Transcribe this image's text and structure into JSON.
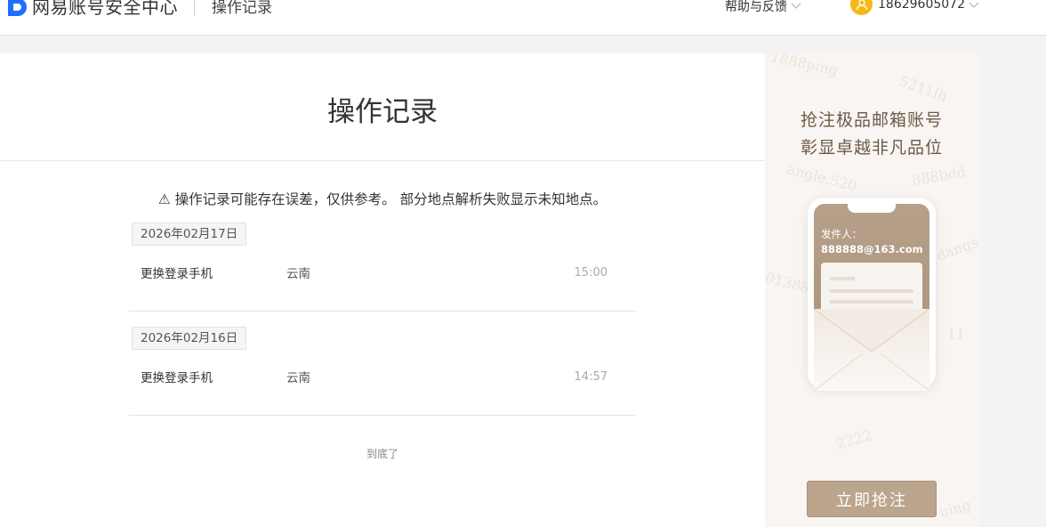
{
  "header": {
    "brand": "网易账号安全中心",
    "page_name": "操作记录",
    "help_label": "帮助与反馈",
    "user_phone": "18629605072"
  },
  "main": {
    "title": "操作记录",
    "notice": "⚠ 操作记录可能存在误差，仅供参考。 部分地点解析失败显示未知地点。",
    "records": [
      {
        "date": "2026年02月17日",
        "action": "更换登录手机",
        "location": "云南",
        "time": "15:00"
      },
      {
        "date": "2026年02月16日",
        "action": "更换登录手机",
        "location": "云南",
        "time": "14:57"
      }
    ],
    "end_text": "到底了"
  },
  "ad": {
    "line1": "抢注极品邮箱账号",
    "line2": "彰显卓越非凡品位",
    "sender_label": "发件人：",
    "sender_email": "888888@163.com",
    "button_label": "立即抢注",
    "watermarks": [
      "1888ping",
      "5211lh",
      "angle.520",
      "888bdd",
      "dangs",
      "01388",
      "2222",
      "11",
      "uing"
    ]
  },
  "colors": {
    "brand_blue": "#1e6fff",
    "avatar_yellow": "#f6b818",
    "ad_button": "#bba58c",
    "ad_text": "#6d5a47"
  },
  "icons": [
    "netease-logo-icon",
    "chevron-down-icon",
    "user-avatar-icon",
    "warning-icon"
  ]
}
